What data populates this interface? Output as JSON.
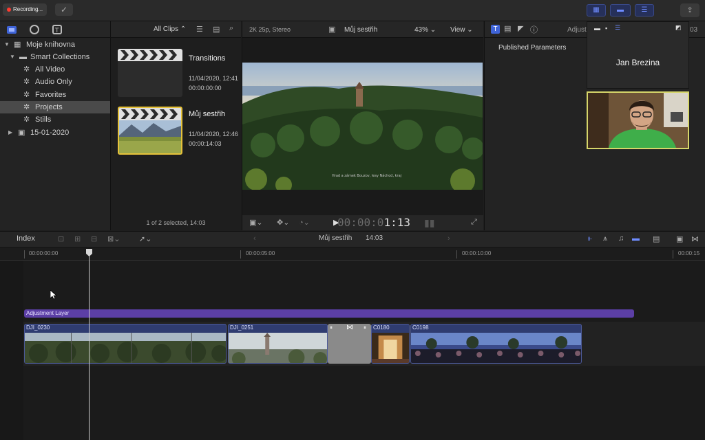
{
  "topbar": {
    "recording_label": "Recording...",
    "check_icon": "checkmark-circle-icon",
    "share_icon": "share-icon"
  },
  "library": {
    "items": [
      {
        "label": "Moje knihovna",
        "type": "library"
      },
      {
        "label": "Smart Collections",
        "type": "folder"
      },
      {
        "label": "All Video",
        "type": "smart"
      },
      {
        "label": "Audio Only",
        "type": "smart"
      },
      {
        "label": "Favorites",
        "type": "smart"
      },
      {
        "label": "Projects",
        "type": "smart",
        "selected": true
      },
      {
        "label": "Stills",
        "type": "smart"
      },
      {
        "label": "15-01-2020",
        "type": "event"
      }
    ]
  },
  "browser": {
    "filter_label": "All Clips",
    "clips": [
      {
        "name": "Transitions",
        "date": "11/04/2020, 12:41",
        "duration": "00:00:00:00"
      },
      {
        "name": "Můj sestřih",
        "date": "11/04/2020, 12:46",
        "duration": "00:00:14:03",
        "selected": true
      }
    ],
    "footer": "1 of 2 selected, 14:03"
  },
  "viewer": {
    "format": "2K 25p, Stereo",
    "project_name": "Můj sestřih",
    "zoom": "43%",
    "view_label": "View",
    "subtitle": "Hrad a zámek Bouzov, lesy Náchod, kraj",
    "timecode_dim": "00:00:0",
    "timecode_lit": "1:13"
  },
  "inspector": {
    "header_label": "Adjust",
    "header_suffix": "03",
    "published_parameters": "Published Parameters"
  },
  "call": {
    "participant_name": "Jan Brezina"
  },
  "timeline": {
    "index_label": "Index",
    "project_name": "Můj sestřih",
    "duration": "14:03",
    "ruler": [
      "00:00:00:00",
      "00:00:05:00",
      "00:00:10:00",
      "00:00:15"
    ],
    "adjustment_layer": "Adjustment Layer",
    "clips": [
      "DJI_0230",
      "DJI_0251",
      "C0180",
      "C0198"
    ]
  },
  "colors": {
    "accent_blue": "#3f64d8",
    "adjustment_purple": "#5c3fa6",
    "clip_blue": "#2f3c70",
    "selection_yellow": "#e6c23a"
  }
}
